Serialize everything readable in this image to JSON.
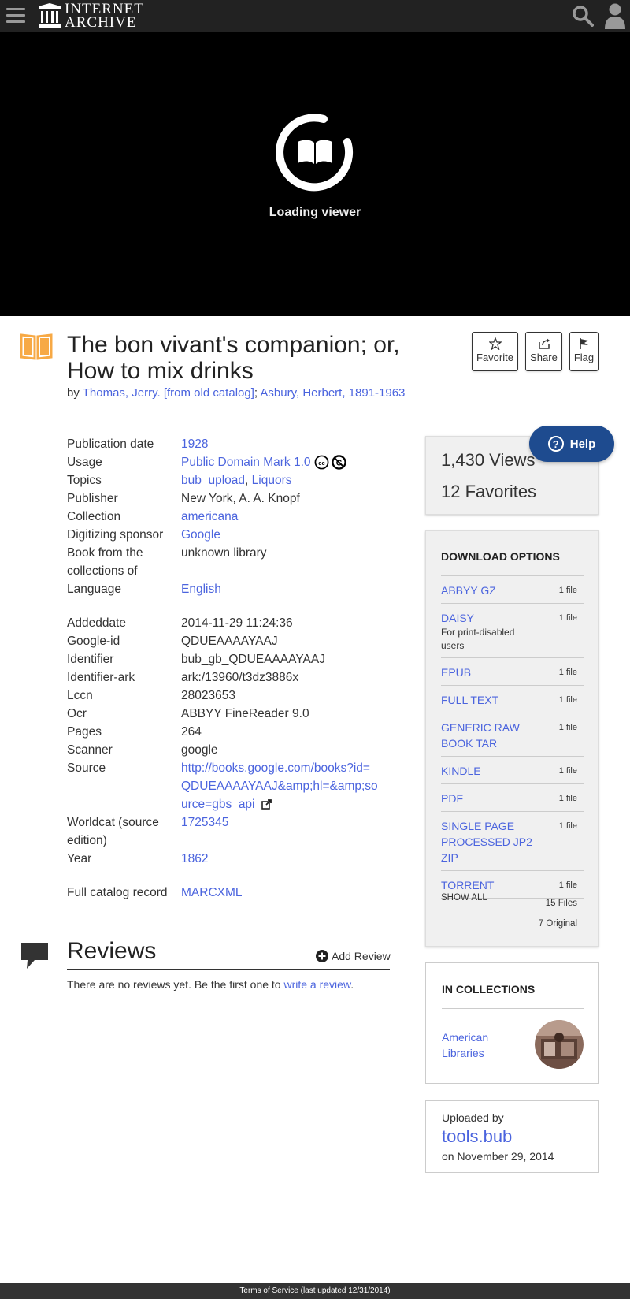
{
  "header": {
    "logo_line1": "INTERNET",
    "logo_line2": "ARCHIVE"
  },
  "viewer": {
    "loading_text": "Loading viewer"
  },
  "item": {
    "title": "The bon vivant's companion; or, How to mix drinks",
    "by_prefix": "by ",
    "authors": [
      "Thomas, Jerry. [from old catalog]",
      "Asbury, Herbert, 1891-1963"
    ],
    "author_separator": "; "
  },
  "actions": {
    "favorite": "Favorite",
    "share": "Share",
    "flag": "Flag"
  },
  "metadata": {
    "rows": [
      {
        "key": "Publication date",
        "value": "1928",
        "link": true
      },
      {
        "key": "Usage",
        "value": "Public Domain Mark 1.0",
        "link": true,
        "cc": true
      },
      {
        "key": "Topics",
        "value": "",
        "link": false,
        "topics": [
          "bub_upload",
          "Liquors"
        ]
      },
      {
        "key": "Publisher",
        "value": "New York, A. A. Knopf",
        "link": false
      },
      {
        "key": "Collection",
        "value": "americana",
        "link": true
      },
      {
        "key": "Digitizing sponsor",
        "value": "Google",
        "link": true
      },
      {
        "key": "Book from the collections of",
        "value": "unknown library",
        "link": false
      },
      {
        "key": "Language",
        "value": "English",
        "link": true
      },
      {
        "gap": true
      },
      {
        "key": "Addeddate",
        "value": "2014-11-29 11:24:36",
        "link": false
      },
      {
        "key": "Google-id",
        "value": "QDUEAAAAYAAJ",
        "link": false
      },
      {
        "key": "Identifier",
        "value": "bub_gb_QDUEAAAAYAAJ",
        "link": false
      },
      {
        "key": "Identifier-ark",
        "value": "ark:/13960/t3dz3886x",
        "link": false
      },
      {
        "key": "Lccn",
        "value": "28023653",
        "link": false
      },
      {
        "key": "Ocr",
        "value": "ABBYY FineReader 9.0",
        "link": false
      },
      {
        "key": "Pages",
        "value": "264",
        "link": false
      },
      {
        "key": "Scanner",
        "value": "google",
        "link": false
      },
      {
        "key": "Source",
        "value": "http://books.google.com/books?id=QDUEAAAAYAAJ&amp;hl=&amp;source=gbs_api",
        "link": true,
        "external": true
      },
      {
        "key": "Worldcat (source edition)",
        "value": "1725345",
        "link": true
      },
      {
        "key": "Year",
        "value": "1862",
        "link": true
      },
      {
        "gap": true
      },
      {
        "key": "Full catalog record",
        "value": "MARCXML",
        "link": true
      }
    ]
  },
  "reviews": {
    "title": "Reviews",
    "add_label": "Add Review",
    "empty_text": "There are no reviews yet. Be the first one to ",
    "write_link": "write a review",
    "end": "."
  },
  "stats": {
    "views": "1,430 Views",
    "favorites": "12 Favorites"
  },
  "help": {
    "label": "Help",
    "icon_glyph": "?"
  },
  "downloads": {
    "title": "DOWNLOAD OPTIONS",
    "items": [
      {
        "name": "ABBYY GZ",
        "count": "1 file"
      },
      {
        "name": "DAISY",
        "sub": "For print-disabled users",
        "count": "1 file"
      },
      {
        "name": "EPUB",
        "count": "1 file"
      },
      {
        "name": "FULL TEXT",
        "count": "1 file"
      },
      {
        "name": "GENERIC RAW BOOK TAR",
        "count": "1 file"
      },
      {
        "name": "KINDLE",
        "count": "1 file"
      },
      {
        "name": "PDF",
        "count": "1 file"
      },
      {
        "name": "SINGLE PAGE PROCESSED JP2 ZIP",
        "count": "1 file"
      },
      {
        "name": "TORRENT",
        "count": "1 file"
      }
    ],
    "show_all": "SHOW ALL",
    "files_total": "15 Files",
    "original_total": "7 Original"
  },
  "collections": {
    "title": "IN COLLECTIONS",
    "item": "American Libraries"
  },
  "uploader": {
    "label": "Uploaded by",
    "name": "tools.bub",
    "date": "on November 29, 2014"
  },
  "footer": {
    "text": "Terms of Service (last updated 12/31/2014)"
  },
  "colors": {
    "link": "#4b64de",
    "nav_bg": "#222222",
    "help_bg": "#1e4b8f",
    "book_icon": "#f7a945"
  }
}
